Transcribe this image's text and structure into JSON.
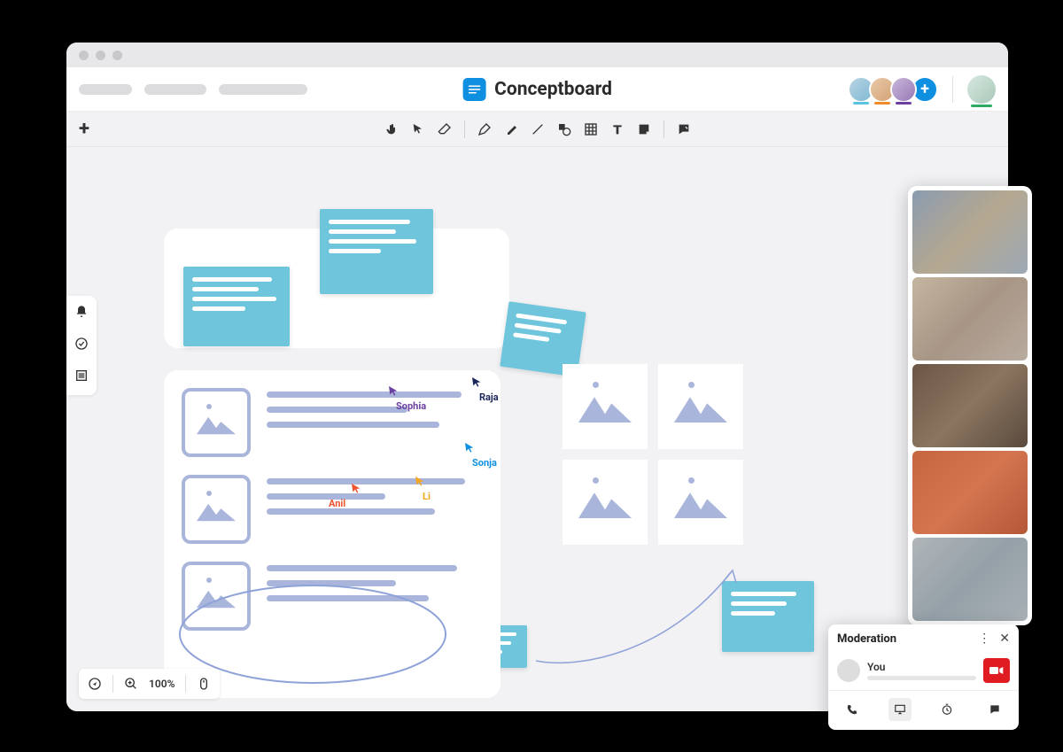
{
  "app": {
    "title": "Conceptboard"
  },
  "header": {
    "avatars": [
      {
        "color": "#5ac4e0"
      },
      {
        "color": "#f08a2b"
      },
      {
        "color": "#6b3fa0"
      }
    ]
  },
  "toolbar": {
    "tools": [
      "hand",
      "select",
      "eraser",
      "pen",
      "highlighter",
      "line",
      "shape",
      "table",
      "text",
      "note",
      "comment"
    ]
  },
  "cursors": {
    "sophia": {
      "label": "Sophia",
      "color": "#6b3fa0"
    },
    "raja": {
      "label": "Raja",
      "color": "#1b2559"
    },
    "sonja": {
      "label": "Sonja",
      "color": "#0f8fe0"
    },
    "li": {
      "label": "Li",
      "color": "#f6a623"
    },
    "anil": {
      "label": "Anil",
      "color": "#f0542f"
    }
  },
  "bottom": {
    "zoom": "100%"
  },
  "moderation": {
    "title": "Moderation",
    "you": "You"
  }
}
